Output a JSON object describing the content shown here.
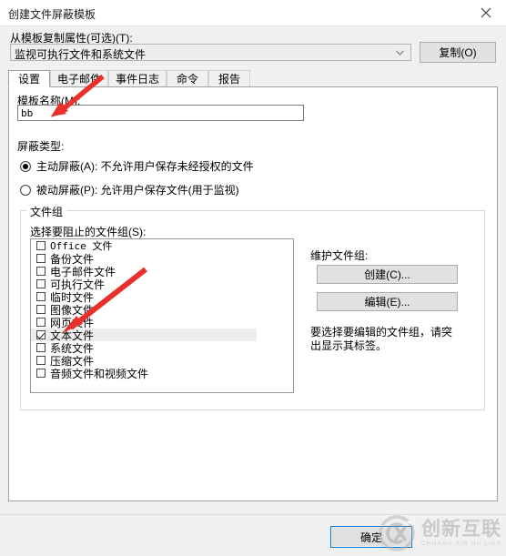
{
  "window": {
    "title": "创建文件屏蔽模板",
    "close_icon": "close-icon"
  },
  "copy_from": {
    "label": "从模板复制属性(可选)(T):",
    "selected_value": "监视可执行文件和系统文件",
    "dropdown_icon": "chevron-down-icon",
    "copy_button": "复制(O)"
  },
  "tabs": [
    {
      "label": "设置",
      "active": true
    },
    {
      "label": "电子邮件",
      "active": false
    },
    {
      "label": "事件日志",
      "active": false
    },
    {
      "label": "命令",
      "active": false
    },
    {
      "label": "报告",
      "active": false
    }
  ],
  "settings": {
    "template_name_label": "模板名称(M):",
    "template_name_value": "bb",
    "template_name_placeholder": "",
    "screening_type_label": "屏蔽类型:",
    "radios": [
      {
        "label": "主动屏蔽(A): 不允许用户保存未经授权的文件",
        "checked": true
      },
      {
        "label": "被动屏蔽(P): 允许用户保存文件(用于监视)",
        "checked": false
      }
    ]
  },
  "file_group": {
    "legend": "文件组",
    "list_label": "选择要阻止的文件组(S):",
    "items": [
      {
        "label": "Office 文件",
        "checked": false,
        "selected": false,
        "mono": true
      },
      {
        "label": "备份文件",
        "checked": false,
        "selected": false,
        "mono": false
      },
      {
        "label": "电子邮件文件",
        "checked": false,
        "selected": false,
        "mono": false
      },
      {
        "label": "可执行文件",
        "checked": false,
        "selected": false,
        "mono": false
      },
      {
        "label": "临时文件",
        "checked": false,
        "selected": false,
        "mono": false
      },
      {
        "label": "图像文件",
        "checked": false,
        "selected": false,
        "mono": false
      },
      {
        "label": "网页文件",
        "checked": false,
        "selected": false,
        "mono": false
      },
      {
        "label": "文本文件",
        "checked": true,
        "selected": true,
        "mono": false
      },
      {
        "label": "系统文件",
        "checked": false,
        "selected": false,
        "mono": false
      },
      {
        "label": "压缩文件",
        "checked": false,
        "selected": false,
        "mono": false
      },
      {
        "label": "音频文件和视频文件",
        "checked": false,
        "selected": false,
        "mono": false
      }
    ],
    "maintain_label": "维护文件组:",
    "create_button": "创建(C)...",
    "edit_button": "编辑(E)...",
    "hint": "要选择要编辑的文件组，请突出显示其标签。"
  },
  "footer": {
    "ok_button": "确定"
  },
  "watermark": {
    "main_text": "创新互联",
    "sub_text": "CHUANG XIN HU LIAN",
    "logo_icon": "cx-circle-logo-icon"
  },
  "annotations": {
    "color": "#e8312a",
    "arrow_1": "red-arrow-to-template-name",
    "arrow_2": "red-arrow-to-text-file-item"
  }
}
